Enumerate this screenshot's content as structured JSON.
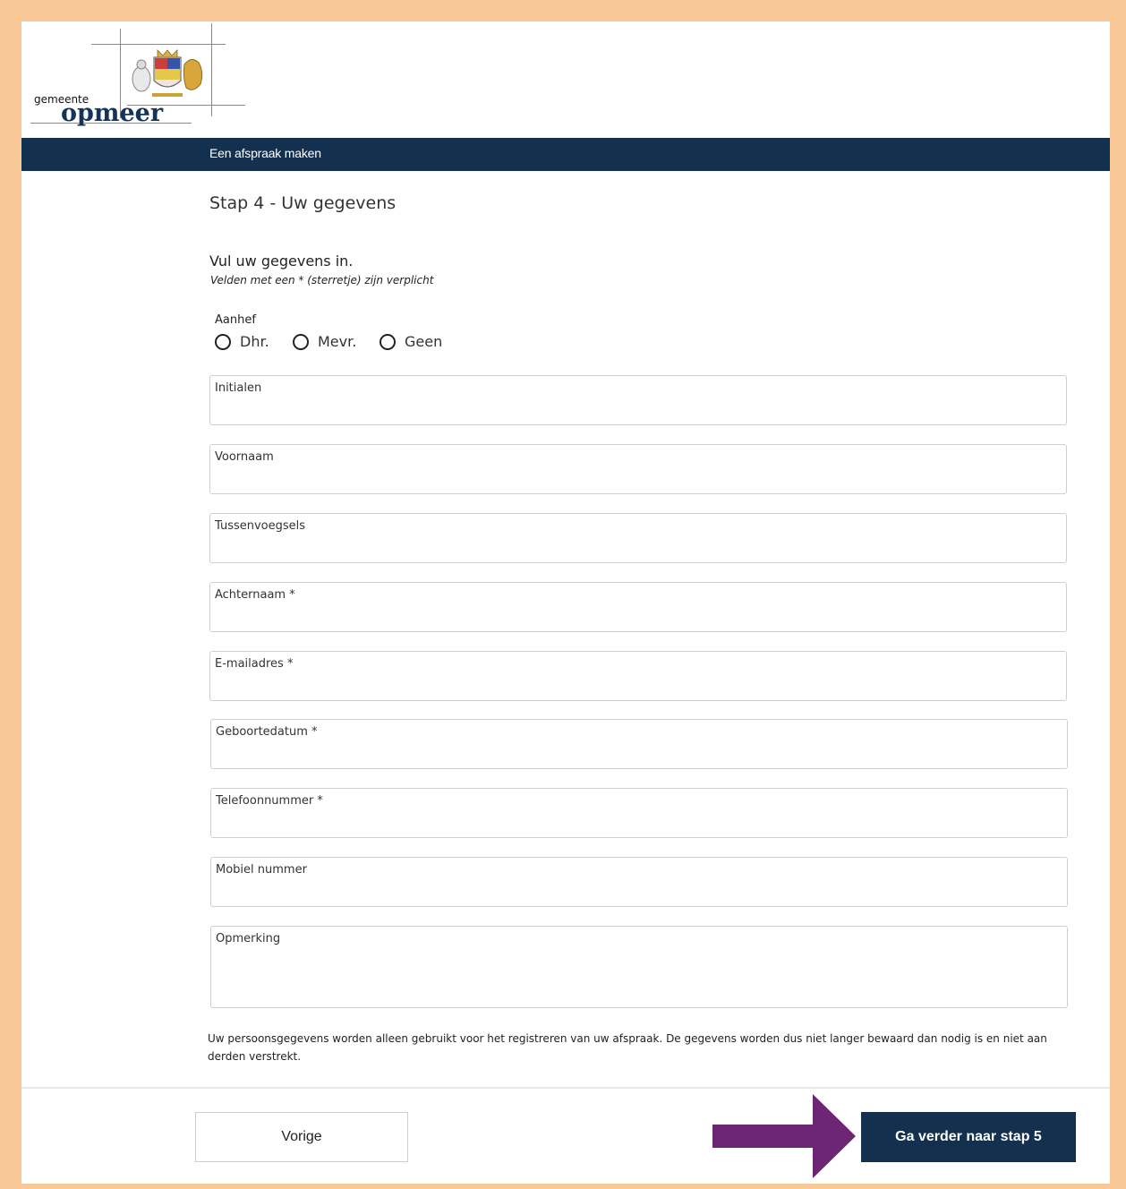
{
  "header": {
    "logo_small": "gemeente",
    "logo_name": "opmeer",
    "navbar_title": "Een afspraak maken"
  },
  "form": {
    "step_title": "Stap 4 - Uw gegevens",
    "intro": "Vul uw gegevens in.",
    "required_note": "Velden met een * (sterretje) zijn verplicht",
    "salutation": {
      "label": "Aanhef",
      "options": [
        "Dhr.",
        "Mevr.",
        "Geen"
      ]
    },
    "fields": {
      "initials": "Initialen",
      "first_name": "Voornaam",
      "infix": "Tussenvoegsels",
      "last_name": "Achternaam *",
      "email": "E-mailadres *",
      "birth_date": "Geboortedatum *",
      "phone": "Telefoonnummer *",
      "mobile": "Mobiel nummer",
      "remark": "Opmerking"
    },
    "privacy_text": "Uw persoonsgegevens worden alleen gebruikt voor het registreren van uw afspraak. De gegevens worden dus niet langer bewaard dan nodig is en niet aan derden verstrekt."
  },
  "footer": {
    "prev_label": "Vorige",
    "next_label": "Ga verder naar stap 5"
  },
  "colors": {
    "brand_navy": "#13304f",
    "frame_border": "#f8c997",
    "arrow": "#6d2673"
  },
  "icons": {
    "arrow": "arrow-right-icon",
    "radio": "radio-unchecked-icon"
  }
}
